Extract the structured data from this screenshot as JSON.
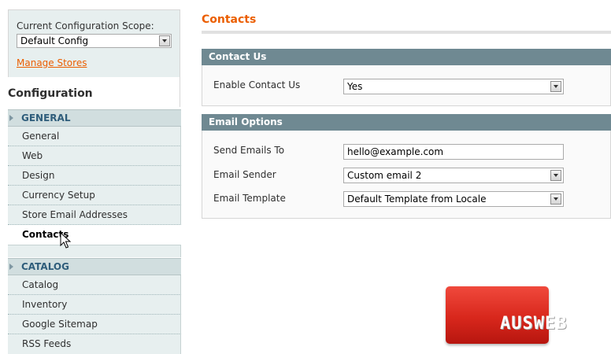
{
  "sidebar": {
    "scope_label": "Current Configuration Scope:",
    "scope_value": "Default Config",
    "manage_stores": "Manage Stores",
    "config_title": "Configuration",
    "sections": [
      {
        "title": "GENERAL",
        "items": [
          "General",
          "Web",
          "Design",
          "Currency Setup",
          "Store Email Addresses",
          "Contacts"
        ]
      },
      {
        "title": "CATALOG",
        "items": [
          "Catalog",
          "Inventory",
          "Google Sitemap",
          "RSS Feeds"
        ]
      }
    ],
    "active_item": "Contacts"
  },
  "main": {
    "page_title": "Contacts",
    "contact_us": {
      "header": "Contact Us",
      "enable_label": "Enable Contact Us",
      "enable_value": "Yes"
    },
    "email_options": {
      "header": "Email Options",
      "send_to_label": "Send Emails To",
      "send_to_value": "hello@example.com",
      "sender_label": "Email Sender",
      "sender_value": "Custom email 2",
      "template_label": "Email Template",
      "template_value": "Default Template from Locale"
    }
  },
  "logo": {
    "text": "AUSWEB"
  },
  "colors": {
    "accent_orange": "#eb5e00",
    "section_header": "#6f8992",
    "sidebar_bg": "#e7efef",
    "logo_red": "#d8271c"
  }
}
